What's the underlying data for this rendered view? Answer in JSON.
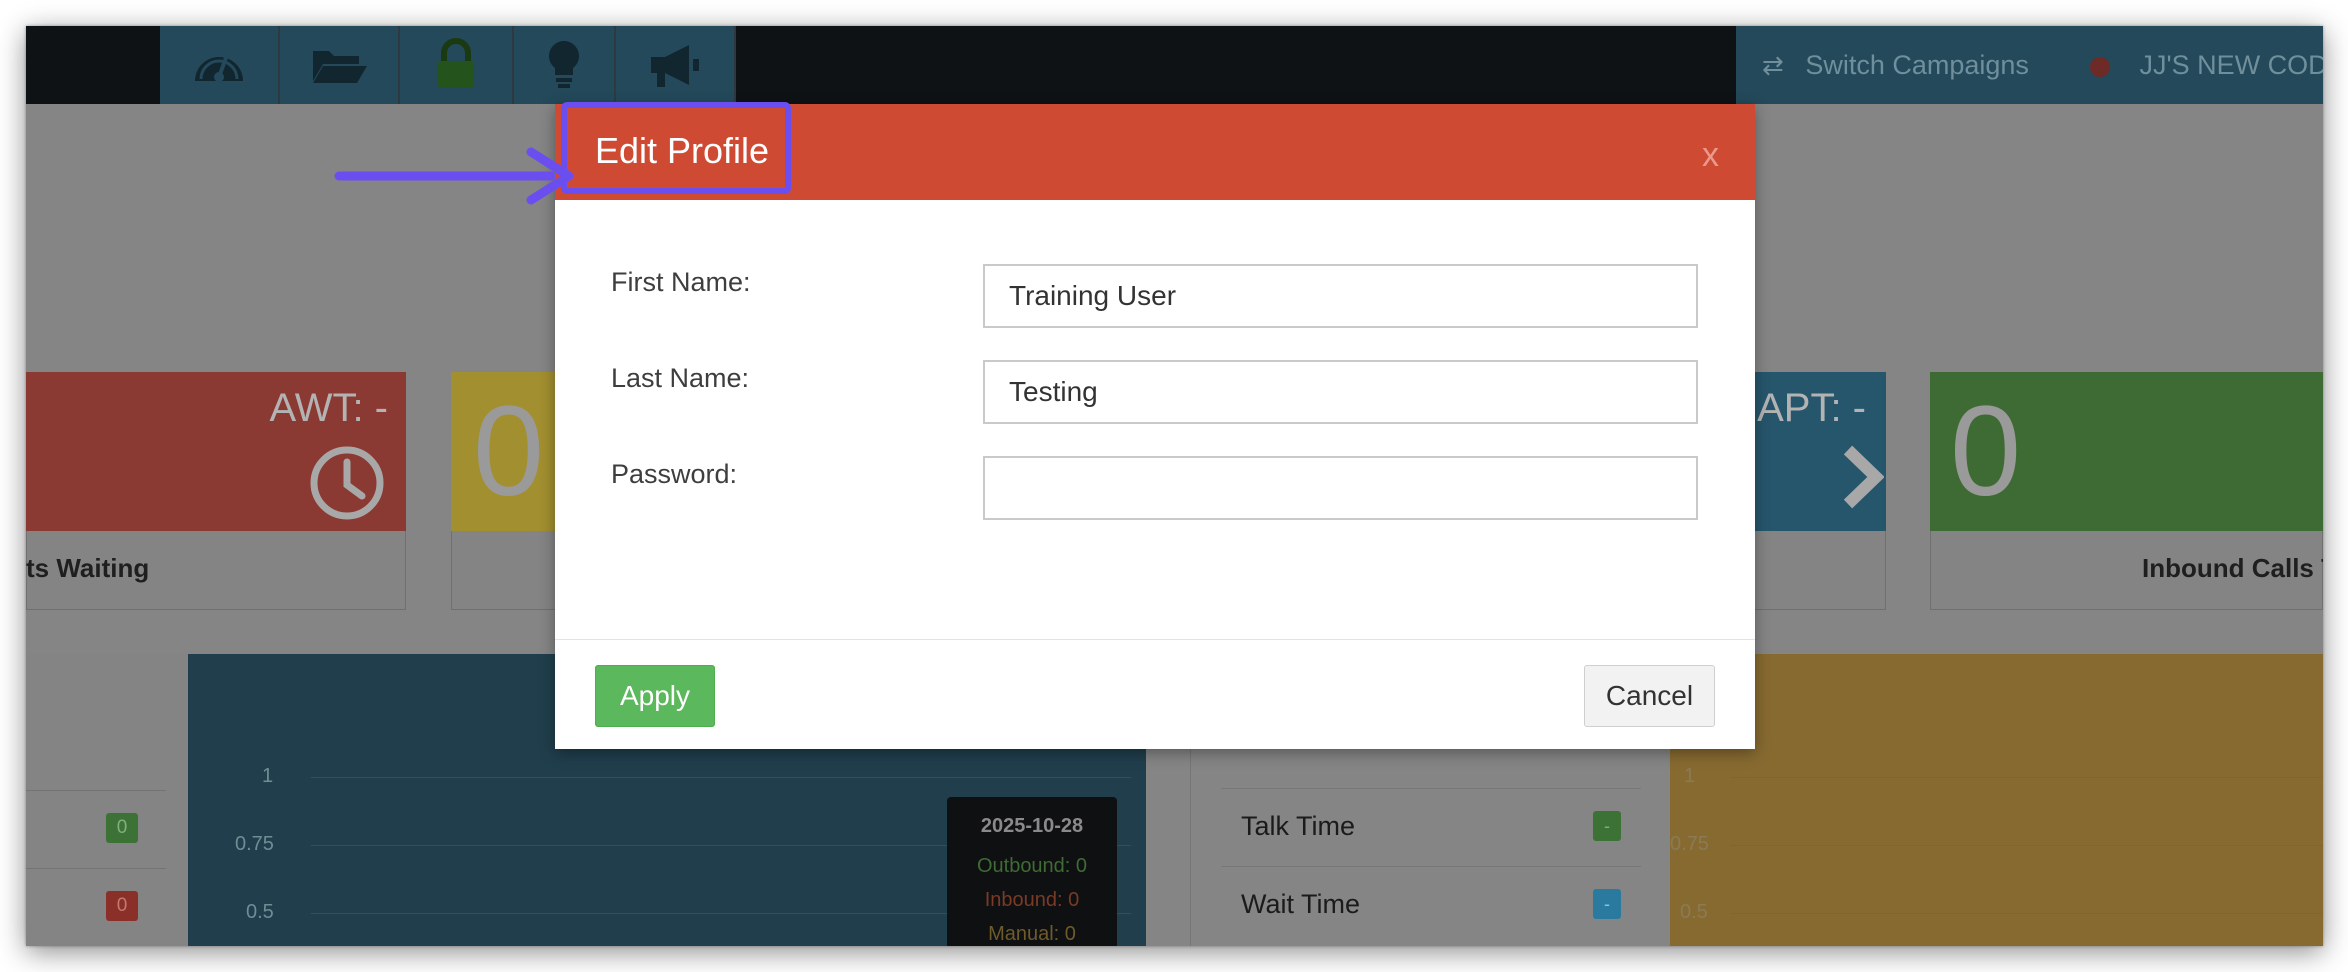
{
  "colors": {
    "modal_header": "#cf4a32",
    "apply_button": "#5cb85c",
    "annotation": "#6b4ef0",
    "nav_dark": "#0f1215",
    "nav_icon_bg": "#23495a"
  },
  "navbar": {
    "icons": [
      "dashboard-gauge-icon",
      "folder-open-icon",
      "lock-icon",
      "lightbulb-icon",
      "megaphone-icon"
    ],
    "switch_campaigns_label": "Switch Campaigns",
    "campaign_name": "JJ'S NEW CODE"
  },
  "dashboard": {
    "tiles": [
      {
        "head": "AWT: -",
        "label": "ts Waiting",
        "icon": "clock-icon",
        "color": "#8a3a32"
      },
      {
        "big_number": "0",
        "color": "#a28f30"
      },
      {
        "head": "APT: -",
        "icon": "chevron-right-icon",
        "color": "#26566c"
      },
      {
        "big_number": "0",
        "label": "Inbound Calls T",
        "color": "#3d6b33"
      }
    ],
    "left_badges": [
      {
        "value": "0",
        "color": "#3d7236"
      },
      {
        "value": "0",
        "color": "#8b3028"
      }
    ],
    "chart_axis_labels": [
      "1",
      "0.75",
      "0.5"
    ],
    "tooltip": {
      "date": "2025-10-28",
      "outbound": "Outbound: 0",
      "inbound": "Inbound: 0",
      "manual": "Manual: 0"
    },
    "stats": [
      {
        "label": "Talk Time",
        "value": "-",
        "color": "#3d7236"
      },
      {
        "label": "Wait Time",
        "value": "-",
        "color": "#2a7aa0"
      }
    ]
  },
  "modal": {
    "title": "Edit Profile",
    "close_symbol": "x",
    "fields": [
      {
        "label": "First Name:",
        "value": "Training User",
        "type": "text"
      },
      {
        "label": "Last Name:",
        "value": "Testing",
        "type": "text"
      },
      {
        "label": "Password:",
        "value": "",
        "type": "password"
      }
    ],
    "apply_label": "Apply",
    "cancel_label": "Cancel"
  }
}
